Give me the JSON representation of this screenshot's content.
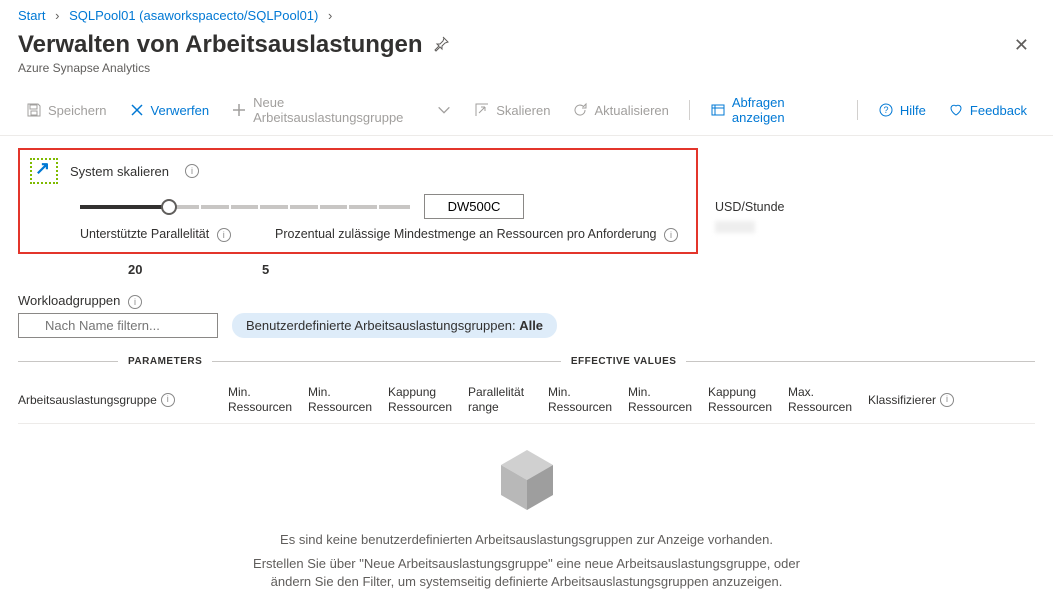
{
  "breadcrumb": {
    "start": "Start",
    "pool": "SQLPool01 (asaworkspacecto/SQLPool01)"
  },
  "header": {
    "title": "Verwalten von Arbeitsauslastungen",
    "subtitle": "Azure Synapse Analytics"
  },
  "toolbar": {
    "save": "Speichern",
    "discard": "Verwerfen",
    "newGroup": "Neue Arbeitsauslastungsgruppe",
    "scale": "Skalieren",
    "refresh": "Aktualisieren",
    "showQueries": "Abfragen anzeigen",
    "help": "Hilfe",
    "feedback": "Feedback"
  },
  "scaleBox": {
    "label": "System skalieren",
    "value": "DW500C",
    "metric1": "Unterstützte Parallelität",
    "metric2": "Prozentual zulässige Mindestmenge an Ressourcen pro Anforderung",
    "metric3": "USD/Stunde",
    "value1": "20",
    "value2": "5"
  },
  "workloadGroups": {
    "label": "Workloadgruppen",
    "filterPlaceholder": "Nach Name filtern...",
    "pillPrefix": "Benutzerdefinierte Arbeitsauslastungsgruppen: ",
    "pillValue": "Alle"
  },
  "sections": {
    "parameters": "PARAMETERS",
    "effective": "EFFECTIVE VALUES"
  },
  "columns": {
    "c1": "Arbeitsauslastungsgruppe",
    "c2a": "Min.",
    "c2b": "Ressourcen",
    "c3a": "Min.",
    "c3b": "Ressourcen",
    "c4a": "Kappung",
    "c4b": "Ressourcen",
    "c5a": "Parallelität",
    "c5b": "range",
    "c6a": "Min.",
    "c6b": "Ressourcen",
    "c7a": "Min.",
    "c7b": "Ressourcen",
    "c8a": "Kappung",
    "c8b": "Ressourcen",
    "c9a": "Max.",
    "c9b": "Ressourcen",
    "c10": "Klassifizierer"
  },
  "empty": {
    "line1": "Es sind keine benutzerdefinierten Arbeitsauslastungsgruppen zur Anzeige vorhanden.",
    "line2": "Erstellen Sie über \"Neue Arbeitsauslastungsgruppe\" eine neue Arbeitsauslastungsgruppe, oder ändern Sie den Filter, um systemseitig definierte Arbeitsauslastungsgruppen anzuzeigen."
  }
}
